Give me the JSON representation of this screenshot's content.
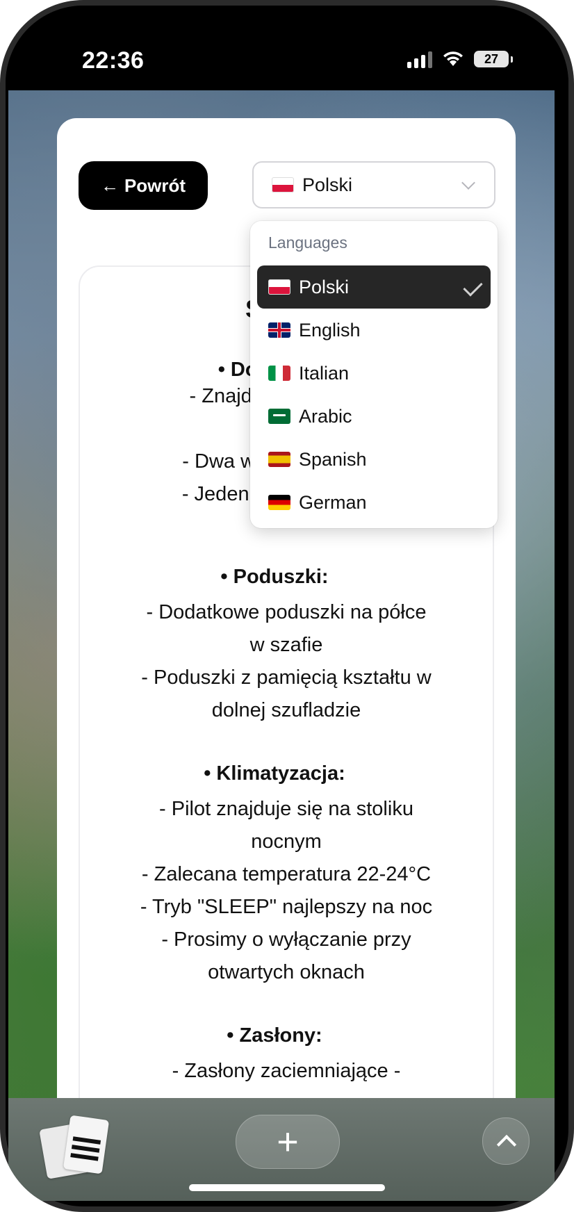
{
  "status_bar": {
    "time": "22:36",
    "battery": "27"
  },
  "header": {
    "back_label": "Powrót",
    "language_selected": "Polski"
  },
  "dropdown": {
    "header": "Languages",
    "options": [
      {
        "label": "Polski",
        "flag": "flag-pl",
        "selected": true
      },
      {
        "label": "English",
        "flag": "flag-gb"
      },
      {
        "label": "Italian",
        "flag": "flag-it"
      },
      {
        "label": "Arabic",
        "flag": "flag-sa"
      },
      {
        "label": "Spanish",
        "flag": "flag-es"
      },
      {
        "label": "German",
        "flag": "flag-de"
      }
    ]
  },
  "content": {
    "title_partial": "Sypialn",
    "section1_head_partial": "• Dod",
    "section1_lines_partial": [
      "- Znajdują",
      "- Dwa wełn",
      "- Jeden lżej"
    ],
    "pillows": {
      "head": "• Poduszki:",
      "lines": [
        "- Dodatkowe poduszki na półce",
        "w szafie",
        "- Poduszki z pamięcią kształtu w",
        "dolnej szufladzie"
      ]
    },
    "ac": {
      "head": "• Klimatyzacja:",
      "lines": [
        "- Pilot znajduje się na stoliku",
        "nocnym",
        "- Zalecana temperatura 22-24°C",
        "- Tryb \"SLEEP\" najlepszy na noc",
        "- Prosimy o wyłączanie przy",
        "otwartych oknach"
      ]
    },
    "curtains": {
      "head": "• Zasłony:",
      "lines": [
        "- Zasłony zaciemniające -"
      ]
    }
  },
  "toolbar": {
    "plus": "+"
  }
}
